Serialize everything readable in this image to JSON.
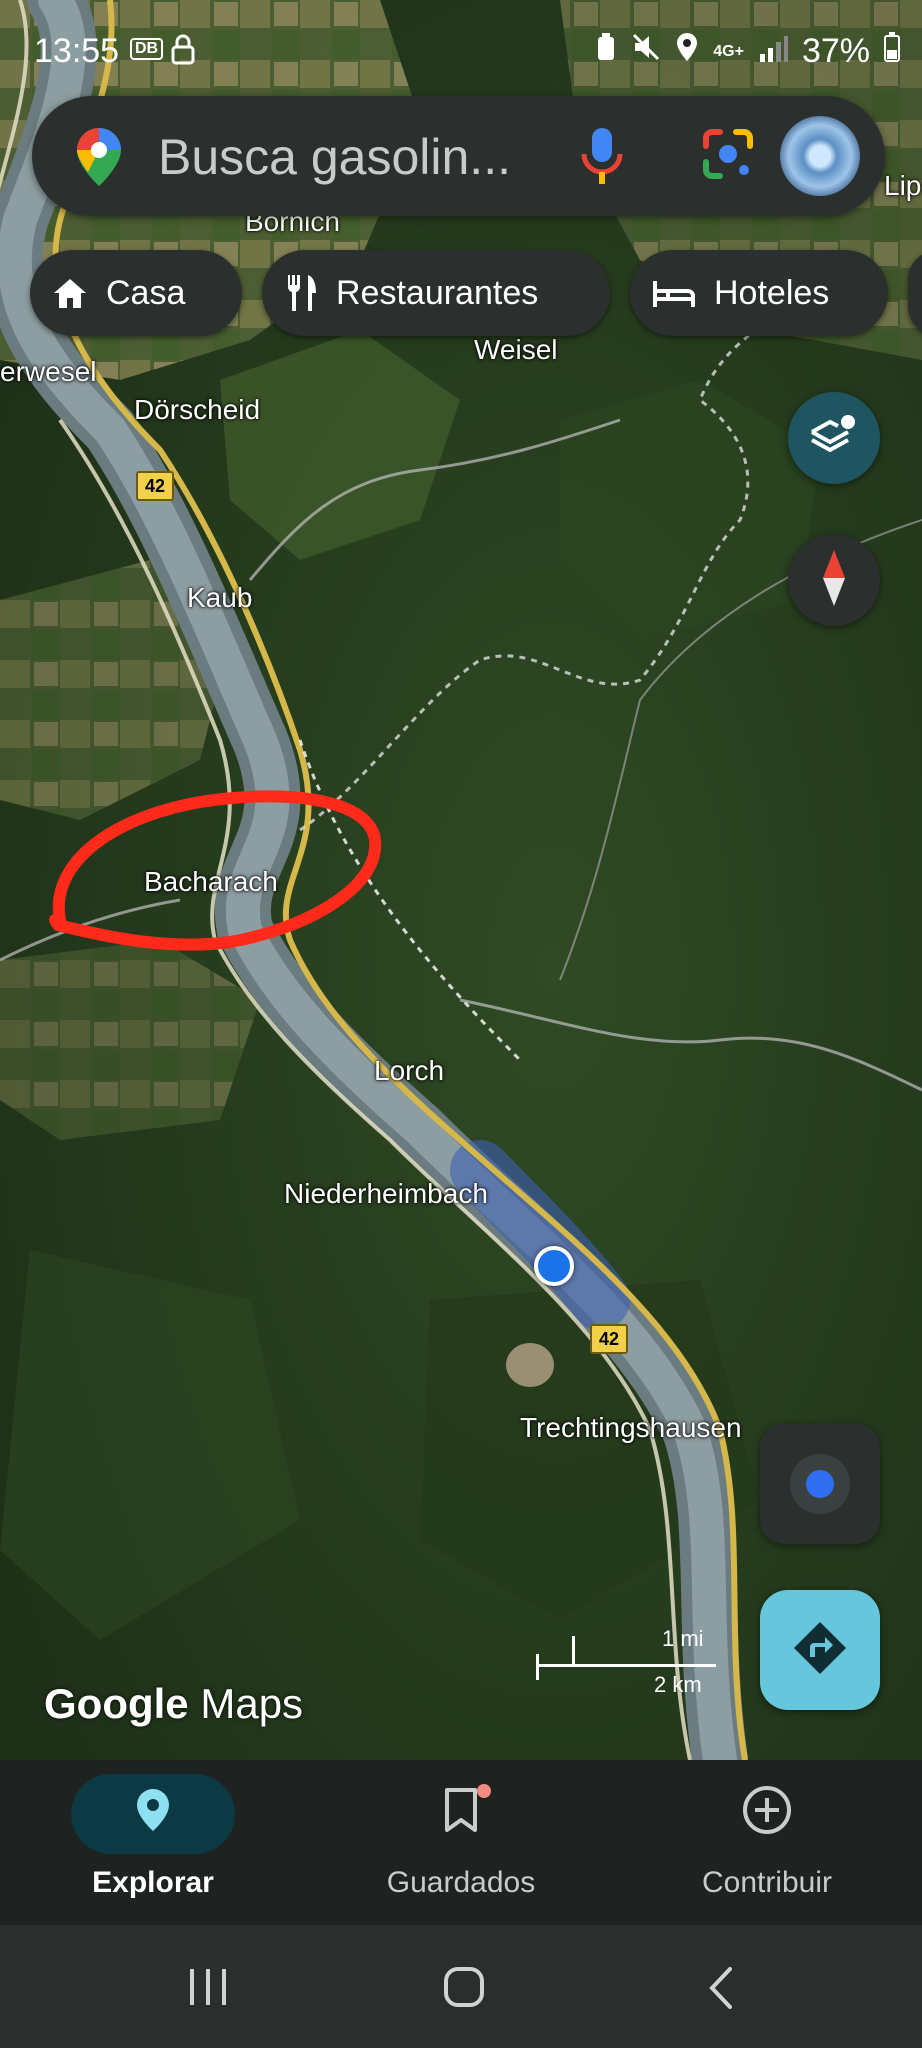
{
  "status_bar": {
    "time": "13:55",
    "db_badge": "DB",
    "signal_label": "4G+",
    "battery": "37%"
  },
  "search": {
    "placeholder": "Busca gasolin..."
  },
  "chips": [
    {
      "label": "Casa"
    },
    {
      "label": "Restaurantes"
    },
    {
      "label": "Hoteles"
    }
  ],
  "map": {
    "places": [
      "Bornich",
      "erwesel",
      "Dörscheid",
      "Weisel",
      "Kaub",
      "Bacharach",
      "Lorch",
      "Niederheimbach",
      "Trechtingshausen",
      "Lip"
    ],
    "road_label": "42",
    "scale": {
      "miles": "1 mi",
      "km": "2 km"
    },
    "watermark": {
      "google": "Google",
      "maps": "Maps"
    }
  },
  "bottom_nav": [
    {
      "label": "Explorar"
    },
    {
      "label": "Guardados"
    },
    {
      "label": "Contribuir"
    }
  ],
  "colors": {
    "accent": "#66c6dc",
    "annotation": "#ff2a1a",
    "location_dot": "#1a73e8"
  }
}
